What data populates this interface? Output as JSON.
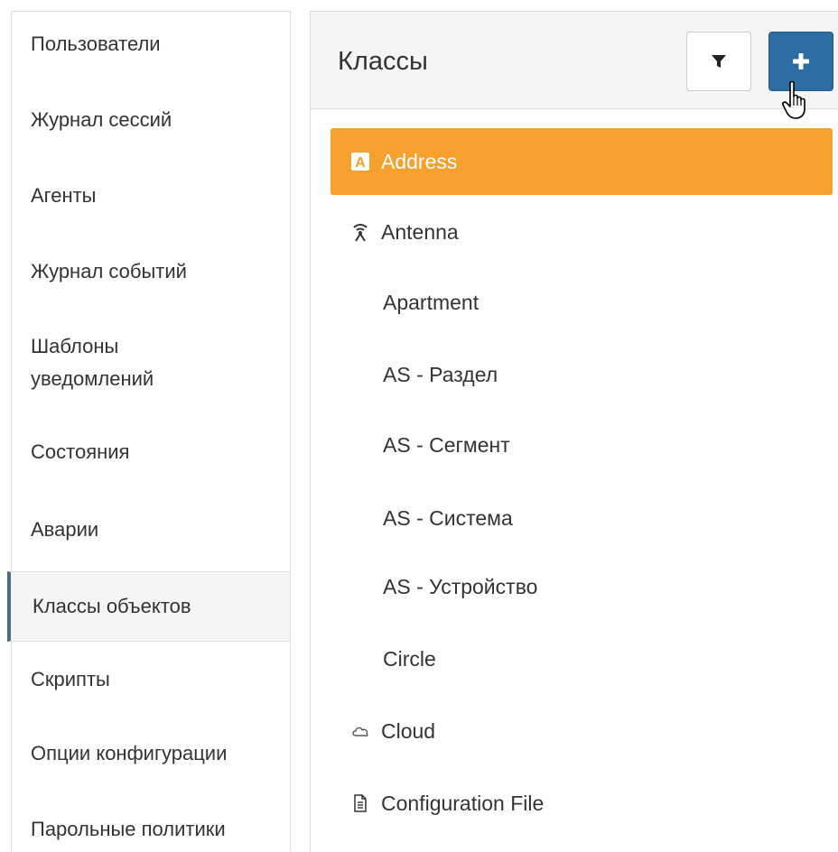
{
  "sidebar": {
    "items": [
      {
        "label": "Пользователи"
      },
      {
        "label": "Журнал сессий"
      },
      {
        "label": "Агенты"
      },
      {
        "label": "Журнал событий"
      },
      {
        "label": "Шаблоны уведомлений"
      },
      {
        "label": "Состояния"
      },
      {
        "label": "Аварии"
      },
      {
        "label": "Классы объектов",
        "active": true
      },
      {
        "label": "Скрипты"
      },
      {
        "label": "Опции конфигурации"
      },
      {
        "label": "Парольные политики"
      }
    ]
  },
  "panel": {
    "title": "Классы",
    "filter_icon": "filter-icon",
    "add_icon": "plus-icon",
    "accent_color": "#f6a02e",
    "primary_button_color": "#2e6da4"
  },
  "classes": [
    {
      "label": "Address",
      "icon": "address-letter-icon",
      "selected": true
    },
    {
      "label": "Antenna",
      "icon": "antenna-icon"
    },
    {
      "label": "Apartment",
      "icon": ""
    },
    {
      "label": "AS - Раздел",
      "icon": ""
    },
    {
      "label": "AS - Сегмент",
      "icon": ""
    },
    {
      "label": "AS - Система",
      "icon": ""
    },
    {
      "label": "AS - Устройство",
      "icon": ""
    },
    {
      "label": "Circle",
      "icon": ""
    },
    {
      "label": "Cloud",
      "icon": "cloud-icon"
    },
    {
      "label": "Configuration File",
      "icon": "file-text-icon"
    }
  ]
}
